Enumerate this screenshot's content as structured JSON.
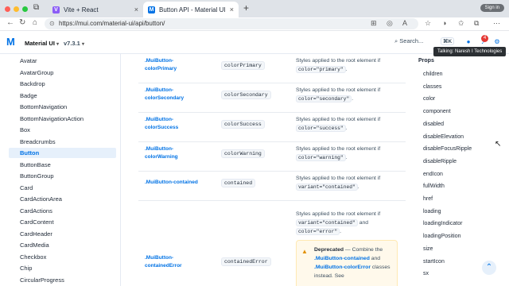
{
  "browser": {
    "tabs": [
      {
        "label": "Vite + React",
        "active": false
      },
      {
        "label": "Button API - Material UI",
        "active": true
      }
    ],
    "new_tab": "+",
    "signin_label": "Sign in",
    "url": "https://mui.com/material-ui/api/button/",
    "nav_icons": [
      "back-icon",
      "refresh-icon",
      "home-icon"
    ]
  },
  "header": {
    "product": "Material UI",
    "version": "v7.3.1",
    "search_label": "Search...",
    "search_shortcut": "⌘K",
    "notification_count": "4"
  },
  "tooltip": "Talking: Naresh I Technologies",
  "sidebar": {
    "items": [
      {
        "label": "Avatar",
        "active": false
      },
      {
        "label": "AvatarGroup",
        "active": false
      },
      {
        "label": "Backdrop",
        "active": false
      },
      {
        "label": "Badge",
        "active": false
      },
      {
        "label": "BottomNavigation",
        "active": false
      },
      {
        "label": "BottomNavigationAction",
        "active": false
      },
      {
        "label": "Box",
        "active": false
      },
      {
        "label": "Breadcrumbs",
        "active": false
      },
      {
        "label": "Button",
        "active": true
      },
      {
        "label": "ButtonBase",
        "active": false
      },
      {
        "label": "ButtonGroup",
        "active": false
      },
      {
        "label": "Card",
        "active": false
      },
      {
        "label": "CardActionArea",
        "active": false
      },
      {
        "label": "CardActions",
        "active": false
      },
      {
        "label": "CardContent",
        "active": false
      },
      {
        "label": "CardHeader",
        "active": false
      },
      {
        "label": "CardMedia",
        "active": false
      },
      {
        "label": "Checkbox",
        "active": false
      },
      {
        "label": "Chip",
        "active": false
      },
      {
        "label": "CircularProgress",
        "active": false
      }
    ]
  },
  "table": {
    "rows": [
      {
        "class_line1": ".MuiButton-",
        "class_line2": "colorPrimary",
        "rule": "colorPrimary",
        "desc_text": "Styles applied to the root element if",
        "desc_code": "color=\"primary\"",
        "desc_end": "."
      },
      {
        "class_line1": ".MuiButton-",
        "class_line2": "colorSecondary",
        "rule": "colorSecondary",
        "desc_text": "Styles applied to the root element if",
        "desc_code": "color=\"secondary\"",
        "desc_end": "."
      },
      {
        "class_line1": ".MuiButton-",
        "class_line2": "colorSuccess",
        "rule": "colorSuccess",
        "desc_text": "Styles applied to the root element if",
        "desc_code": "color=\"success\"",
        "desc_end": "."
      },
      {
        "class_line1": ".MuiButton-",
        "class_line2": "colorWarning",
        "rule": "colorWarning",
        "desc_text": "Styles applied to the root element if",
        "desc_code": "color=\"warning\"",
        "desc_end": "."
      },
      {
        "class_line1": ".MuiButton-contained",
        "class_line2": "",
        "rule": "contained",
        "desc_text": "Styles applied to the root element if",
        "desc_code": "variant=\"contained\"",
        "desc_end": "."
      }
    ],
    "error_row": {
      "class_line1": ".MuiButton-",
      "class_line2": "containedError",
      "rule": "containedError",
      "desc_text": "Styles applied to the root element if",
      "desc_code1": "variant=\"contained\"",
      "desc_and": "and",
      "desc_code2": "color=\"error\"",
      "desc_end": ".",
      "deprecated_label": "Deprecated",
      "deprecated_text": "— Combine the",
      "deprecated_class1": ".MuiButton-contained",
      "deprecated_and": "and",
      "deprecated_class2": ".MuiButton-colorError",
      "deprecated_tail": "classes instead. See"
    }
  },
  "toc": {
    "heading": "Props",
    "items": [
      "children",
      "classes",
      "color",
      "component",
      "disabled",
      "disableElevation",
      "disableFocusRipple",
      "disableRipple",
      "endIcon",
      "fullWidth",
      "href",
      "loading",
      "loadingIndicator",
      "loadingPosition",
      "size",
      "startIcon",
      "sx"
    ]
  },
  "colors": {
    "accent": "#0072e5",
    "active_bg": "#e6f0fb",
    "warning_bg": "#fff9eb"
  }
}
